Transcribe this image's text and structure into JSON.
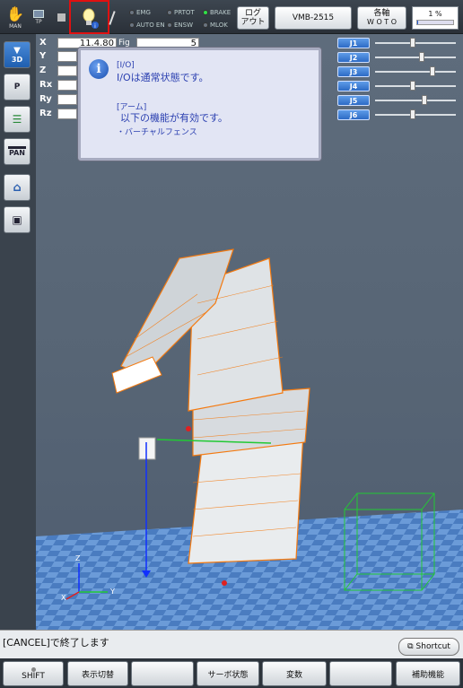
{
  "topbar": {
    "mode_icons": [
      {
        "icon": "hand-icon",
        "label": "MAN"
      },
      {
        "icon": "teach-pendant-icon",
        "label": "TP"
      }
    ],
    "status_leds": [
      {
        "label": "EMG",
        "on": false
      },
      {
        "label": "PRTOT",
        "on": false
      },
      {
        "label": "BRAKE",
        "on": true
      },
      {
        "label": "AUTO EN",
        "on": false
      },
      {
        "label": "ENSW",
        "on": false
      },
      {
        "label": "MLOK",
        "on": false
      }
    ],
    "logout_label_1": "ログ",
    "logout_label_2": "アウト",
    "robot_model": "VMB-2515",
    "axis_btn_1": "各軸",
    "axis_btn_2": "W O T O",
    "speed_value": "1 %",
    "speed_fraction": 0.01
  },
  "left_toolbar": {
    "items": [
      {
        "icon": "view-3d-icon",
        "label": "3D",
        "active": true
      },
      {
        "icon": "point-icon",
        "label": "P"
      },
      {
        "icon": "list-icon",
        "label": ""
      },
      {
        "icon": "pan-icon",
        "label": "PAN"
      },
      {
        "icon": "home-icon",
        "label": ""
      },
      {
        "icon": "box-icon",
        "label": ""
      }
    ]
  },
  "coordinates": {
    "x_label": "X",
    "y_label": "Y",
    "z_label": "Z",
    "rx_label": "Rx",
    "ry_label": "Ry",
    "rz_label": "Rz",
    "x_value": "11.4.80",
    "fig_label": "Fig",
    "fig_value": "5"
  },
  "joints": [
    {
      "label": "J1",
      "pos": 0.45
    },
    {
      "label": "J2",
      "pos": 0.57
    },
    {
      "label": "J3",
      "pos": 0.71
    },
    {
      "label": "J4",
      "pos": 0.45
    },
    {
      "label": "J5",
      "pos": 0.61
    },
    {
      "label": "J6",
      "pos": 0.45
    }
  ],
  "popup": {
    "io_tag": "[I/O]",
    "io_msg": "I/Oは通常状態です。",
    "arm_tag": "[アーム]",
    "arm_msg": "以下の機能が有効です。",
    "arm_item": "・バーチャルフェンス"
  },
  "status_bar": {
    "message": "[CANCEL]で終了します",
    "shortcut_label": "Shortcut"
  },
  "function_keys": [
    "SHIFT",
    "表示切替",
    "",
    "サーボ状態",
    "変数",
    "",
    "補助機能"
  ],
  "axes_labels": {
    "x": "X",
    "y": "Y",
    "z": "Z"
  },
  "colors": {
    "robot_wire": "#f47a10",
    "fence": "#21c934",
    "axis_z": "#1030ff",
    "floor_a": "#3a6bb0",
    "floor_b": "#5a8bd0"
  }
}
